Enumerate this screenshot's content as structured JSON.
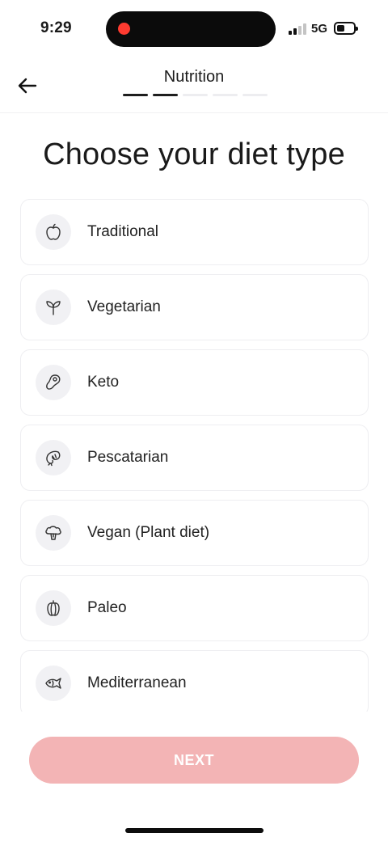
{
  "status_bar": {
    "time": "9:29",
    "network": "5G"
  },
  "header": {
    "back_icon": "arrow-left-icon",
    "title": "Nutrition",
    "progress": {
      "total_steps": 5,
      "completed_steps": 2
    }
  },
  "page": {
    "title": "Choose your diet type"
  },
  "diet_options": [
    {
      "label": "Traditional",
      "icon": "apple-icon"
    },
    {
      "label": "Vegetarian",
      "icon": "sprout-icon"
    },
    {
      "label": "Keto",
      "icon": "steak-icon"
    },
    {
      "label": "Pescatarian",
      "icon": "shrimp-icon"
    },
    {
      "label": "Vegan (Plant diet)",
      "icon": "broccoli-icon"
    },
    {
      "label": "Paleo",
      "icon": "pepper-icon"
    },
    {
      "label": "Mediterranean",
      "icon": "fish-icon"
    }
  ],
  "actions": {
    "next_label": "NEXT"
  },
  "colors": {
    "next_disabled": "#f3b4b5",
    "recording_dot": "#ff3b30",
    "progress_active": "#1e1e1e",
    "progress_inactive": "#ededf0"
  }
}
